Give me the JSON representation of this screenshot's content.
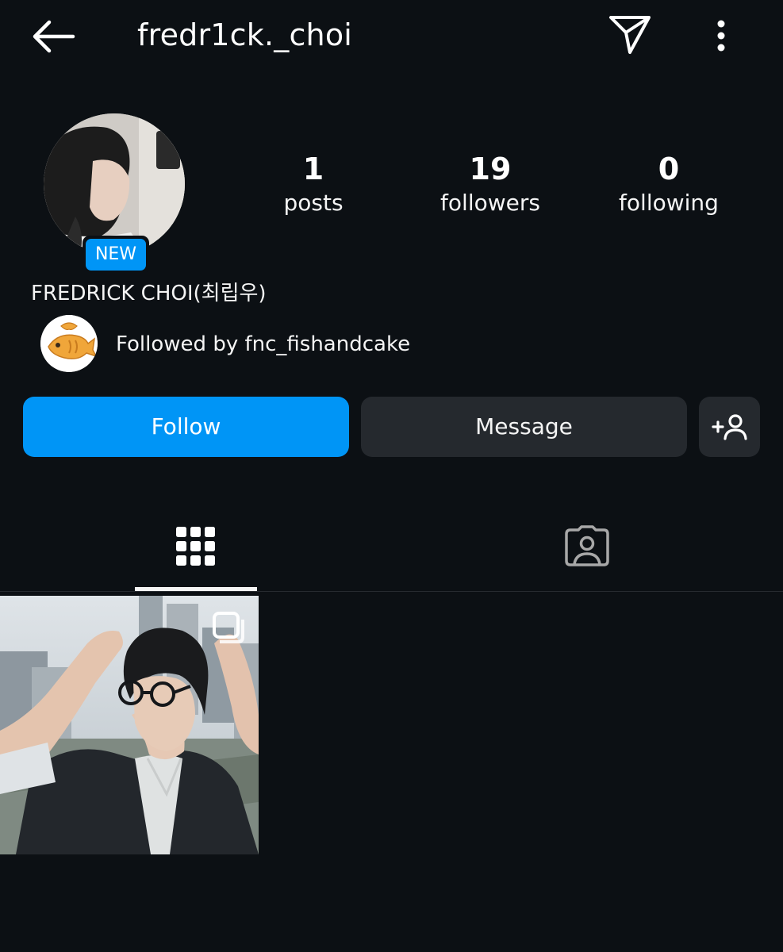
{
  "header": {
    "username": "fredr1ck._choi",
    "back_icon": "arrow-left-icon",
    "send_icon": "paper-plane-icon",
    "more_icon": "more-vertical-icon"
  },
  "profile": {
    "badge": "NEW",
    "full_name": "FREDRICK CHOI(최립우)",
    "followed_by": "Followed by fnc_fishandcake"
  },
  "stats": {
    "posts": {
      "value": "1",
      "label": "posts"
    },
    "followers": {
      "value": "19",
      "label": "followers"
    },
    "following": {
      "value": "0",
      "label": "following"
    }
  },
  "actions": {
    "follow": "Follow",
    "message": "Message",
    "add_user_icon": "add-user-icon"
  },
  "tabs": {
    "grid_icon": "grid-icon",
    "tagged_icon": "tagged-person-icon",
    "active": "grid"
  },
  "colors": {
    "background": "#0c1014",
    "accent": "#0095f6",
    "button": "#25292e"
  }
}
